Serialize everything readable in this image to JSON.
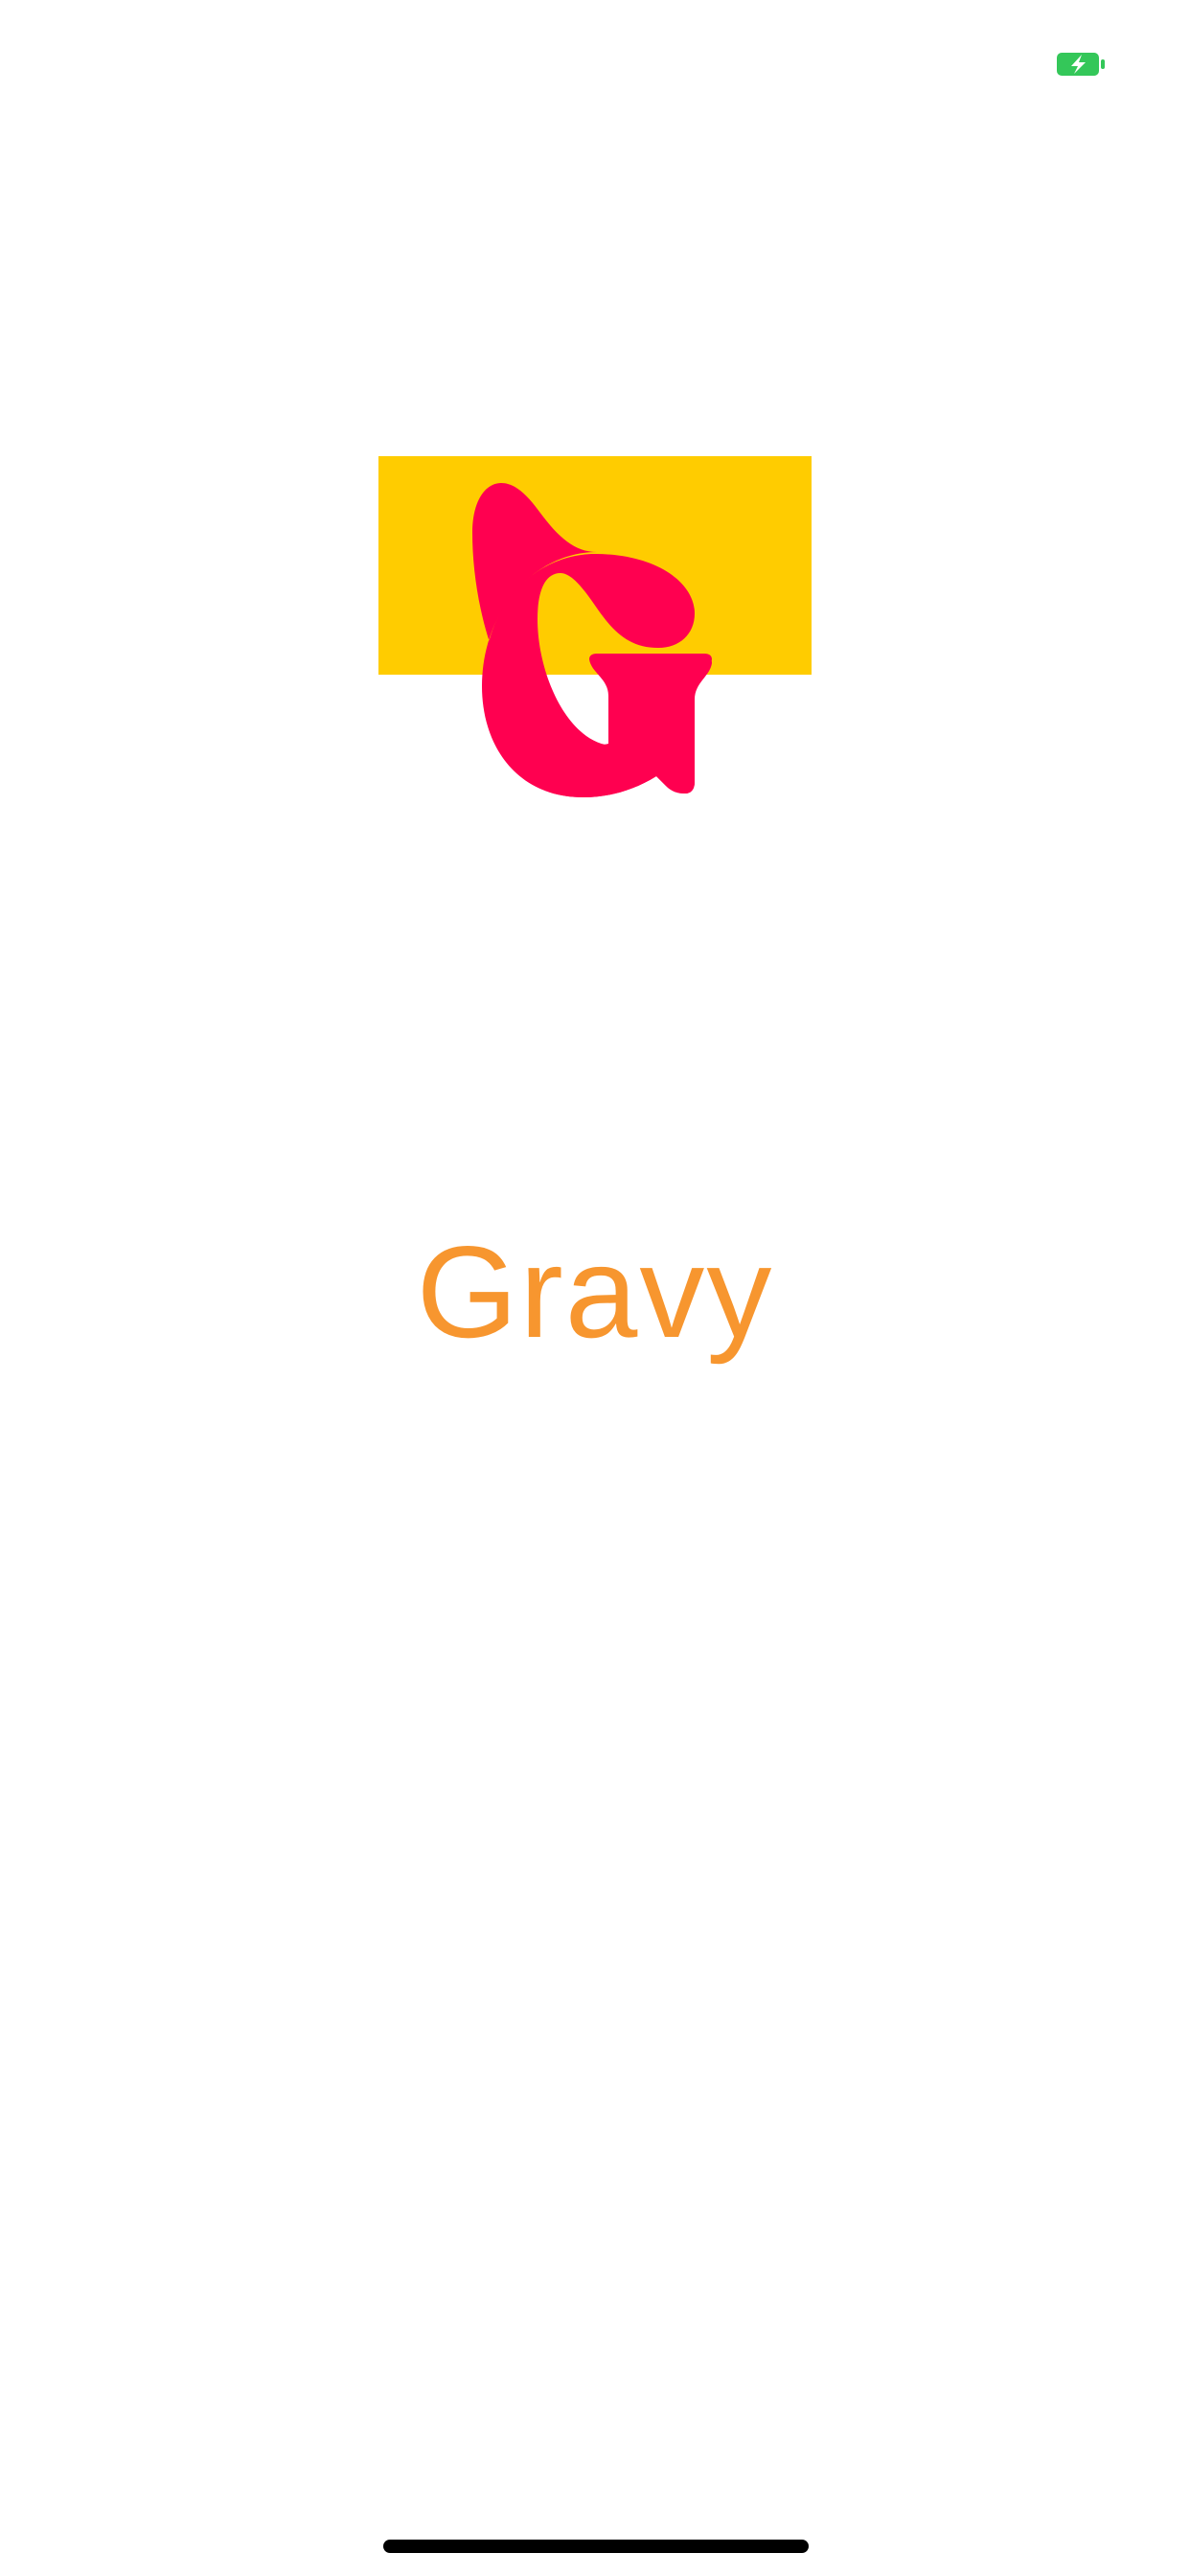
{
  "app": {
    "name": "Gravy"
  },
  "status_bar": {
    "battery_icon": "battery-charging-icon",
    "battery_color": "#34c759"
  },
  "splash": {
    "logo_icon": "gravy-logo-icon",
    "logo_letter": "G",
    "logo_block_color": "#ffcc00",
    "logo_letter_color": "#ff0050",
    "wordmark": "Gravy",
    "wordmark_color": "#f7962f"
  },
  "system": {
    "home_indicator_icon": "home-indicator"
  }
}
